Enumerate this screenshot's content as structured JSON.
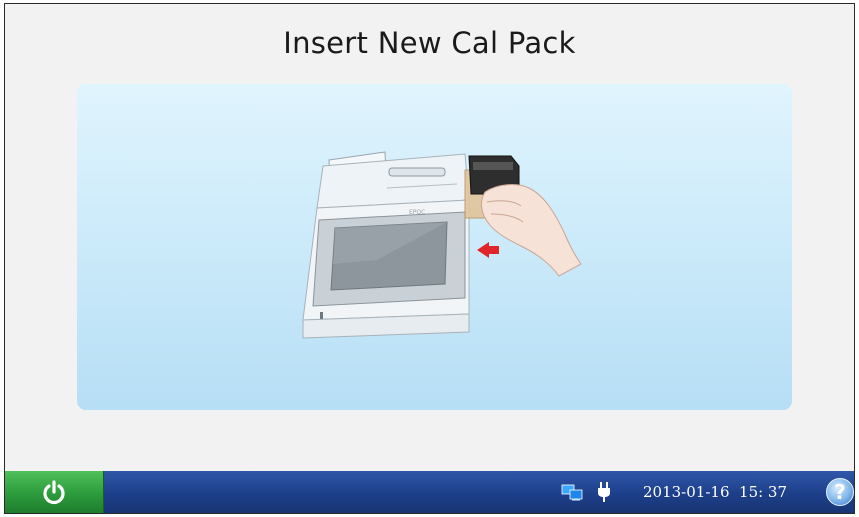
{
  "screen": {
    "title": "Insert New Cal Pack"
  },
  "illustration": {
    "subject": "hand inserting cal pack into analyzer port",
    "arrow_color": "#e0262a"
  },
  "taskbar": {
    "power_icon": "power-icon",
    "network_icon": "network-icon",
    "plug_icon": "ac-power-plug-icon",
    "datetime": "2013-01-16  15: 37",
    "help_label": "?",
    "colors": {
      "bar": "#1d3f8a",
      "power_button": "#2c9b3c"
    }
  }
}
